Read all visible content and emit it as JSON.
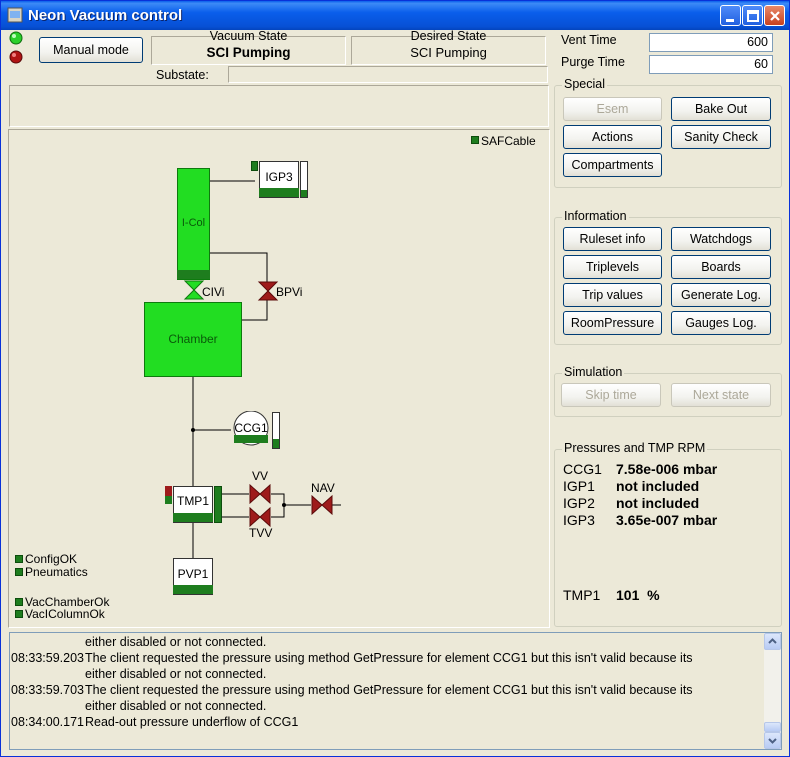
{
  "window": {
    "title": "Neon Vacuum control"
  },
  "header": {
    "manual_mode_label": "Manual mode",
    "vacuum_state_caption": "Vacuum State",
    "vacuum_state_value": "SCI Pumping",
    "desired_state_caption": "Desired State",
    "desired_state_value": "SCI Pumping",
    "substate_label": "Substate:",
    "substate_value": ""
  },
  "settings": {
    "vent_time_label": "Vent Time",
    "vent_time_value": "600",
    "purge_time_label": "Purge Time",
    "purge_time_value": "60"
  },
  "special": {
    "title": "Special",
    "esem": "Esem",
    "bake_out": "Bake Out",
    "actions": "Actions",
    "sanity_check": "Sanity Check",
    "compartments": "Compartments"
  },
  "information": {
    "title": "Information",
    "ruleset_info": "Ruleset info",
    "watchdogs": "Watchdogs",
    "triplevels": "Triplevels",
    "boards": "Boards",
    "trip_values": "Trip values",
    "generate_log": "Generate Log.",
    "room_pressure": "RoomPressure",
    "gauges_log": "Gauges Log."
  },
  "simulation": {
    "title": "Simulation",
    "skip_time": "Skip time",
    "next_state": "Next state"
  },
  "pressures": {
    "title": "Pressures and TMP RPM",
    "rows": [
      {
        "name": "CCG1",
        "value": "7.58e-006 mbar"
      },
      {
        "name": "IGP1",
        "value": "not included"
      },
      {
        "name": "IGP2",
        "value": "not included"
      },
      {
        "name": "IGP3",
        "value": "3.65e-007 mbar"
      }
    ],
    "tmp_name": "TMP1",
    "tmp_value": "101  %"
  },
  "diagram": {
    "saf_cable": "SAFCable",
    "icol": "I-Col",
    "igp3": "IGP3",
    "civi": "CIVi",
    "bpvi": "BPVi",
    "chamber": "Chamber",
    "ccg1": "CCG1",
    "vv": "VV",
    "nav": "NAV",
    "tvv": "TVV",
    "tmp1": "TMP1",
    "pvp1": "PVP1",
    "legend": {
      "config_ok": "ConfigOK",
      "pneumatics": "Pneumatics",
      "vac_chamber_ok": "VacChamberOk",
      "vac_column_ok": "VacIColumnOk"
    },
    "colors": {
      "vacuum_green": "#22DD22",
      "valve_red": "#9E1B1B",
      "status_green": "#1E7D1E"
    }
  },
  "log": {
    "lines": [
      {
        "time": "",
        "text": "either disabled or not connected."
      },
      {
        "time": "08:33:59.203",
        "text": "The client requested the pressure using method GetPressure for element CCG1 but this isn't valid because its"
      },
      {
        "time": "",
        "text": "either disabled or not connected."
      },
      {
        "time": "08:33:59.703",
        "text": "The client requested the pressure using method GetPressure for element CCG1 but this isn't valid because its"
      },
      {
        "time": "",
        "text": "either disabled or not connected."
      },
      {
        "time": "08:34:00.171",
        "text": "Read-out pressure underflow of CCG1"
      }
    ]
  }
}
